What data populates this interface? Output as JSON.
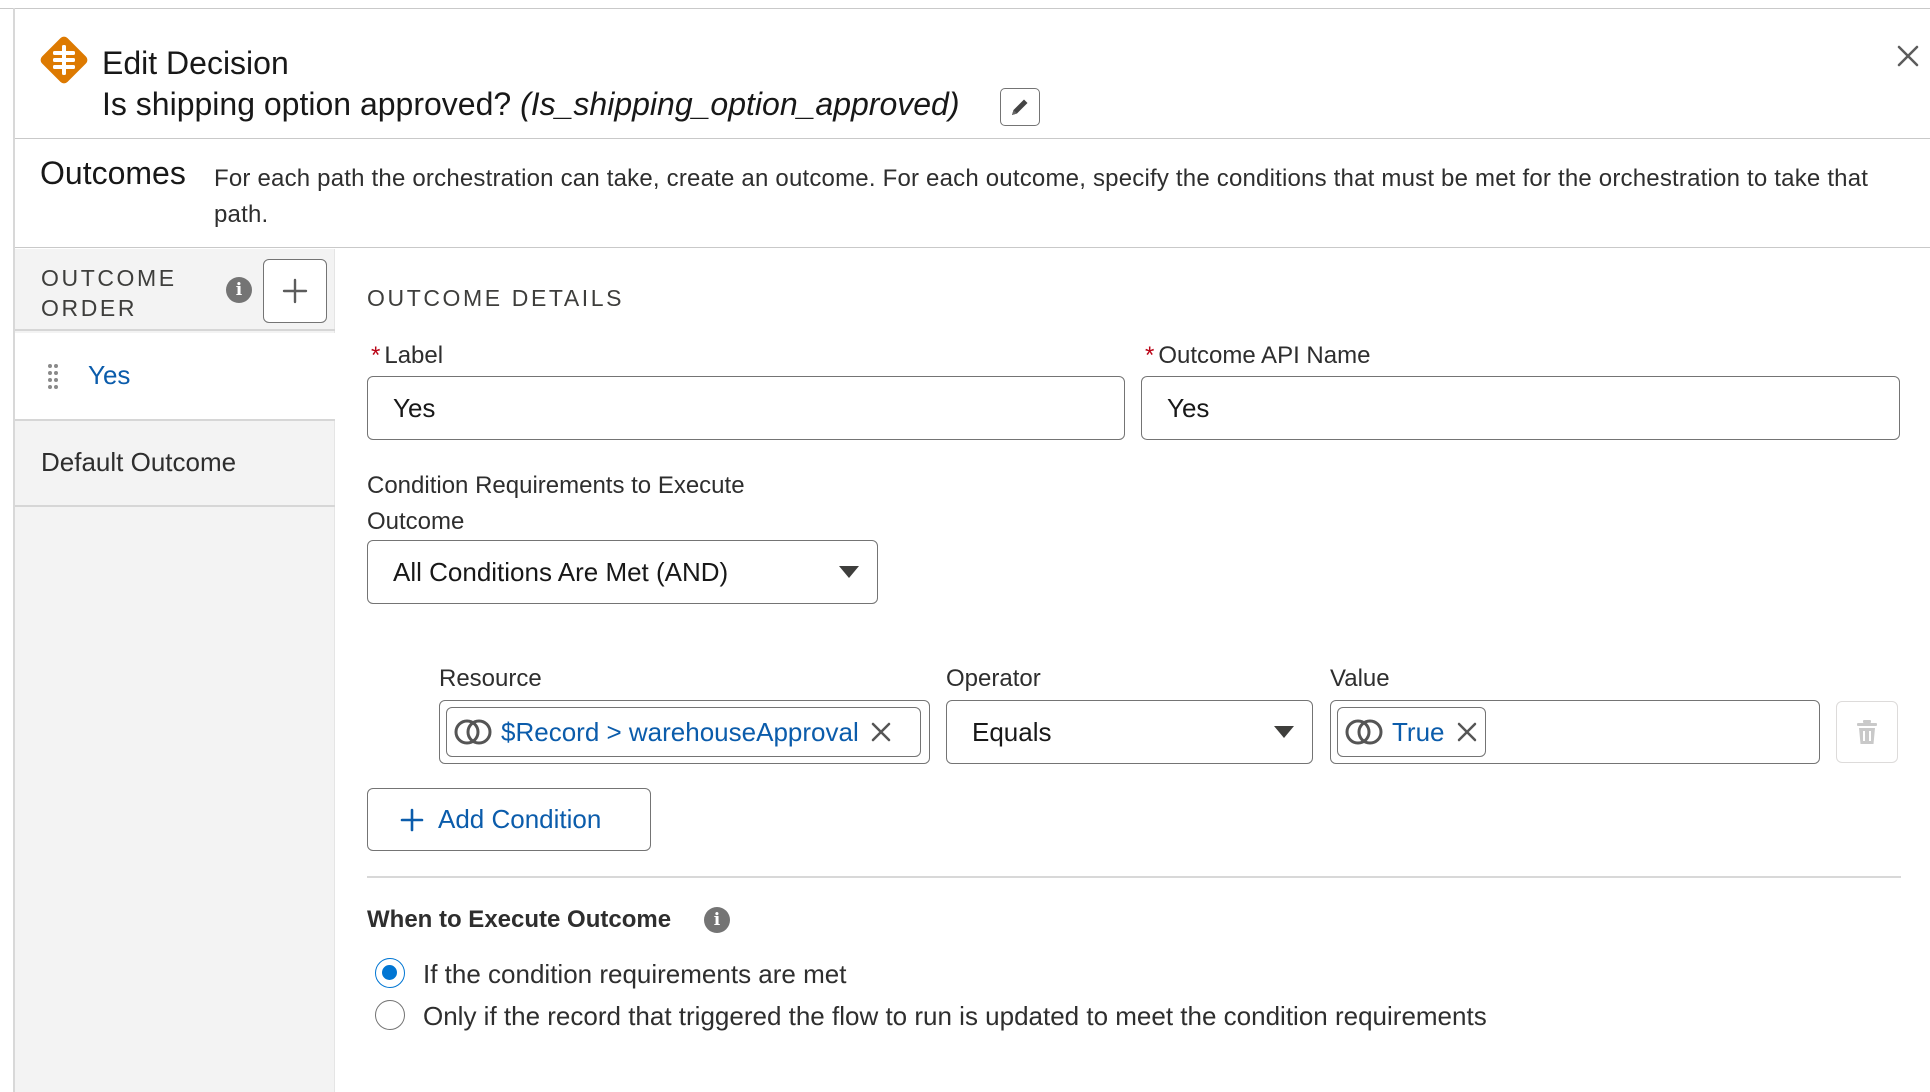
{
  "header": {
    "title": "Edit Decision",
    "decision_label": "Is shipping option approved?",
    "decision_api_name": "(Is_shipping_option_approved)",
    "icon": "decision-icon",
    "icon_color": "#dd7a01"
  },
  "outcomes": {
    "title": "Outcomes",
    "description": "For each path the orchestration can take, create an outcome. For each outcome, specify the conditions that must be met for the orchestration to take that path."
  },
  "sidebar": {
    "order_heading": "OUTCOME ORDER",
    "items": [
      {
        "label": "Yes",
        "selected": true
      },
      {
        "label": "Default Outcome",
        "selected": false
      }
    ]
  },
  "details": {
    "section_title": "OUTCOME DETAILS",
    "label_field": {
      "label": "Label",
      "value": "Yes",
      "required": true
    },
    "api_name_field": {
      "label": "Outcome API Name",
      "value": "Yes",
      "required": true
    },
    "condition_requirements": {
      "label": "Condition Requirements to Execute Outcome",
      "value": "All Conditions Are Met (AND)"
    },
    "condition": {
      "resource_label": "Resource",
      "resource_value": "$Record > warehouseApproval",
      "operator_label": "Operator",
      "operator_value": "Equals",
      "value_label": "Value",
      "value_value": "True"
    },
    "add_condition_label": "Add Condition",
    "when_to_execute": {
      "title": "When to Execute Outcome",
      "options": [
        {
          "label": "If the condition requirements are met",
          "checked": true
        },
        {
          "label": "Only if the record that triggered the flow to run is updated to meet the condition requirements",
          "checked": false
        }
      ]
    }
  },
  "colors": {
    "link_blue": "#0b5cab",
    "brand_blue": "#0176d3",
    "required_red": "#ba0517",
    "sidebar_bg": "#f3f3f3"
  }
}
